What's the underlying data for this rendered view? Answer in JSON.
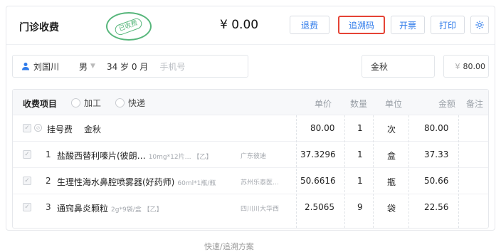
{
  "header": {
    "title": "门诊收费",
    "stamp_text": "已收费",
    "total": "¥ 0.00",
    "buttons": {
      "refund": "退费",
      "trace": "追溯码",
      "invoice": "开票",
      "print": "打印"
    }
  },
  "patient": {
    "name": "刘国川",
    "sex": "男",
    "age": "34 岁  0 月",
    "phone_placeholder": "手机号",
    "doctor": "金秋",
    "amount": "80.00",
    "currency": "¥"
  },
  "table": {
    "label": "收费项目",
    "options": [
      "加工",
      "快递"
    ],
    "columns": {
      "price": "单价",
      "qty": "数量",
      "unit": "单位",
      "amount": "金额",
      "note": "备注"
    },
    "rows": [
      {
        "num": "",
        "name": "挂号费",
        "doctor": "金秋",
        "spec": "",
        "mfr": "",
        "price": "80.00",
        "qty": "1",
        "unit": "次",
        "amount": "80.00"
      },
      {
        "num": "1",
        "name": "盐酸西替利嗪片(彼朗…",
        "doctor": "",
        "spec": "10mg*12片… 【乙】",
        "mfr": "广东彼迪",
        "price": "37.3296",
        "qty": "1",
        "unit": "盒",
        "amount": "37.33"
      },
      {
        "num": "2",
        "name": "生理性海水鼻腔喷雾器(好药师)",
        "doctor": "",
        "spec": "60ml*1瓶/瓶",
        "mfr": "苏州乐泰医…",
        "price": "50.6616",
        "qty": "1",
        "unit": "瓶",
        "amount": "50.66"
      },
      {
        "num": "3",
        "name": "通窍鼻炎颗粒",
        "doctor": "",
        "spec": "2g*9袋/盒 【乙】",
        "mfr": "四川川大华西",
        "price": "2.5065",
        "qty": "9",
        "unit": "袋",
        "amount": "22.56"
      }
    ]
  },
  "caption": "快速/追溯方案"
}
